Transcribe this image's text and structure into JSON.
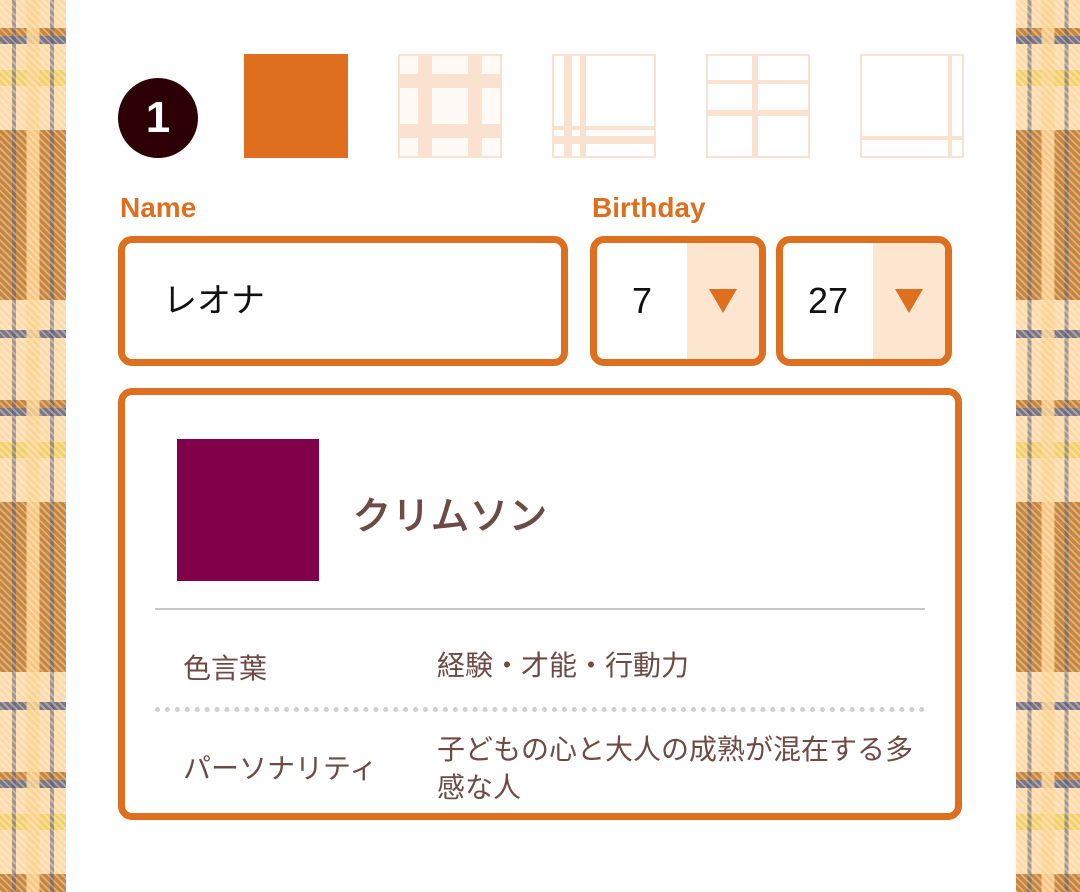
{
  "step_number": "1",
  "patterns": [
    {
      "name": "solid",
      "selected": true,
      "color": "#dd6f1f"
    },
    {
      "name": "large-check",
      "selected": false
    },
    {
      "name": "corner-plaid",
      "selected": false
    },
    {
      "name": "window-pane",
      "selected": false
    },
    {
      "name": "border-line",
      "selected": false
    }
  ],
  "form": {
    "name_label": "Name",
    "name_value": "レオナ",
    "birthday_label": "Birthday",
    "month_value": "7",
    "day_value": "27"
  },
  "result": {
    "color_hex": "#80004a",
    "color_name": "クリムソン",
    "rows": [
      {
        "label": "色言葉",
        "value": "経験・才能・行動力"
      },
      {
        "label": "パーソナリティ",
        "value": "子どもの心と大人の成熟が混在する多感な人"
      }
    ]
  },
  "colors": {
    "accent": "#dd6f1f",
    "text_brown": "#6e4a44",
    "arrow_bg": "#fde6cf"
  }
}
